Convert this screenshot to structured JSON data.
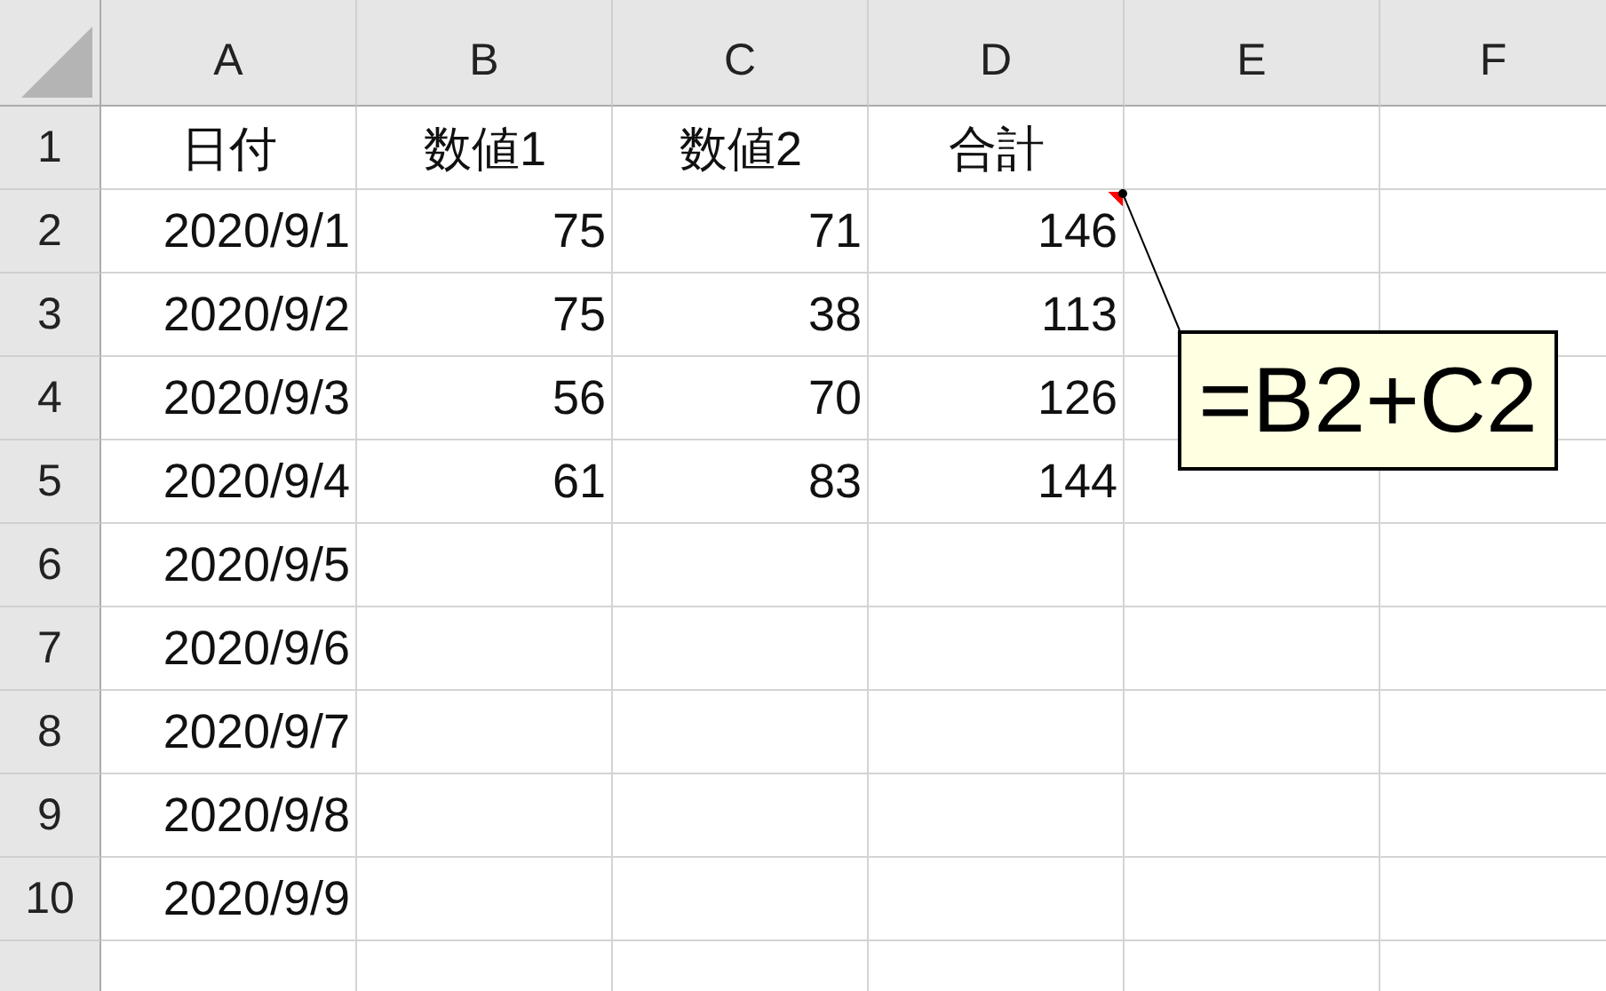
{
  "columns": [
    "A",
    "B",
    "C",
    "D",
    "E",
    "F"
  ],
  "rows": [
    {
      "label": "1",
      "kind": "header",
      "cells": [
        "日付",
        "数値1",
        "数値2",
        "合計",
        "",
        ""
      ]
    },
    {
      "label": "2",
      "kind": "data",
      "cells": [
        "2020/9/1",
        "75",
        "71",
        {
          "text": "146",
          "has_comment": true
        },
        "",
        ""
      ]
    },
    {
      "label": "3",
      "kind": "data",
      "cells": [
        "2020/9/2",
        "75",
        "38",
        "113",
        "",
        ""
      ]
    },
    {
      "label": "4",
      "kind": "data",
      "cells": [
        "2020/9/3",
        "56",
        "70",
        "126",
        "",
        ""
      ]
    },
    {
      "label": "5",
      "kind": "data",
      "cells": [
        "2020/9/4",
        "61",
        "83",
        "144",
        "",
        ""
      ]
    },
    {
      "label": "6",
      "kind": "data",
      "cells": [
        "2020/9/5",
        "",
        "",
        "",
        "",
        ""
      ]
    },
    {
      "label": "7",
      "kind": "data",
      "cells": [
        "2020/9/6",
        "",
        "",
        "",
        "",
        ""
      ]
    },
    {
      "label": "8",
      "kind": "data",
      "cells": [
        "2020/9/7",
        "",
        "",
        "",
        "",
        ""
      ]
    },
    {
      "label": "9",
      "kind": "data",
      "cells": [
        "2020/9/8",
        "",
        "",
        "",
        "",
        ""
      ]
    },
    {
      "label": "10",
      "kind": "data",
      "cells": [
        "2020/9/9",
        "",
        "",
        "",
        "",
        ""
      ]
    }
  ],
  "comment": {
    "text": "=B2+C2"
  }
}
